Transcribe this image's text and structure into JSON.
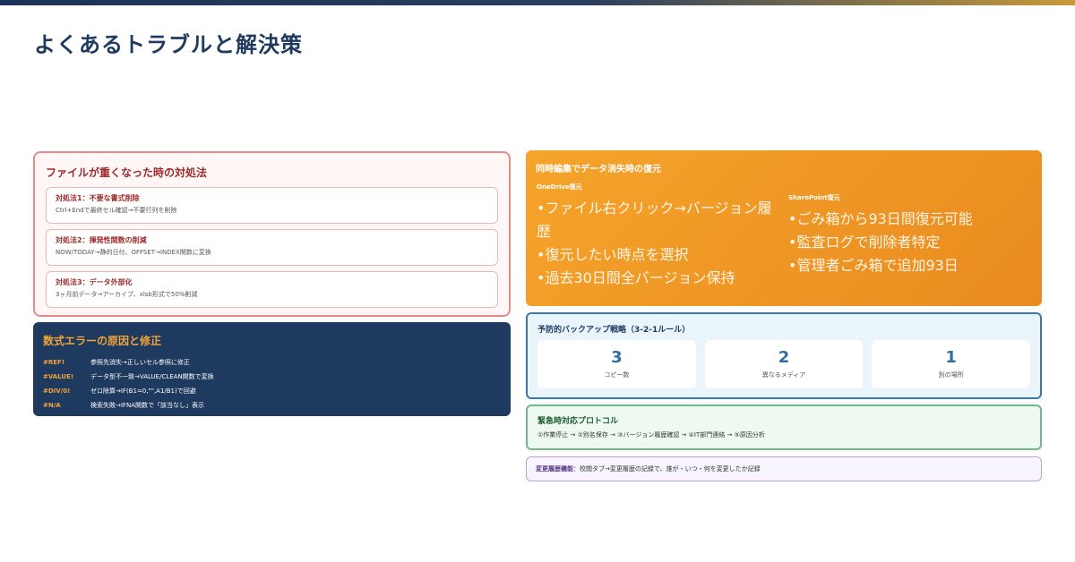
{
  "title": "よくあるトラブルと解決策",
  "perf": {
    "header": "ファイルが重くなった時の対処法",
    "fixes": [
      {
        "title": "対処法1：不要な書式削除",
        "desc": "Ctrl+Endで最終セル確認→不要行列を削除"
      },
      {
        "title": "対処法2：揮発性関数の削減",
        "desc": "NOW/TODAY→静的日付、OFFSET→INDEX関数に変換"
      },
      {
        "title": "対処法3：データ外部化",
        "desc": "3ヶ月前データ→アーカイブ、xlsb形式で50%削減"
      }
    ]
  },
  "errors": {
    "header": "数式エラーの原因と修正",
    "rows": [
      {
        "code": "#REF!",
        "desc": "参照先消失→正しいセル参照に修正"
      },
      {
        "code": "#VALUE!",
        "desc": "データ型不一致→VALUE/CLEAN関数で変換"
      },
      {
        "code": "#DIV/0!",
        "desc": "ゼロ除算→IF(B1=0,\"\",A1/B1)で回避"
      },
      {
        "code": "#N/A",
        "desc": "検索失敗→IFNA関数で「該当なし」表示"
      }
    ]
  },
  "recover": {
    "header": "同時編集でデータ消失時の復元",
    "onedrive": {
      "label": "OneDrive復元",
      "items": [
        "•ファイル右クリック→バージョン履歴",
        "•復元したい時点を選択",
        "•過去30日間全バージョン保持"
      ]
    },
    "sharepoint": {
      "label": "SharePoint復元",
      "items": [
        "•ごみ箱から93日間復元可能",
        "•監査ログで削除者特定",
        "•管理者ごみ箱で追加93日"
      ]
    }
  },
  "backup": {
    "header": "予防的バックアップ戦略（3-2-1ルール）",
    "stats": [
      {
        "num": "3",
        "label": "コピー数"
      },
      {
        "num": "2",
        "label": "異なるメディア"
      },
      {
        "num": "1",
        "label": "別の場所"
      }
    ]
  },
  "emergency": {
    "header": "緊急時対応プロトコル",
    "steps": "①作業停止 → ②別名保存 → ③バージョン履歴確認 → ④IT部門連絡 → ⑤原因分析"
  },
  "history": {
    "key": "変更履歴機能",
    "text": "：校閲タブ→変更履歴の記録で、誰が・いつ・何を変更したか記録"
  },
  "colors": {
    "navy": "#1e3a5f",
    "orange": "#f29a26",
    "red": "#9e2a2a"
  }
}
